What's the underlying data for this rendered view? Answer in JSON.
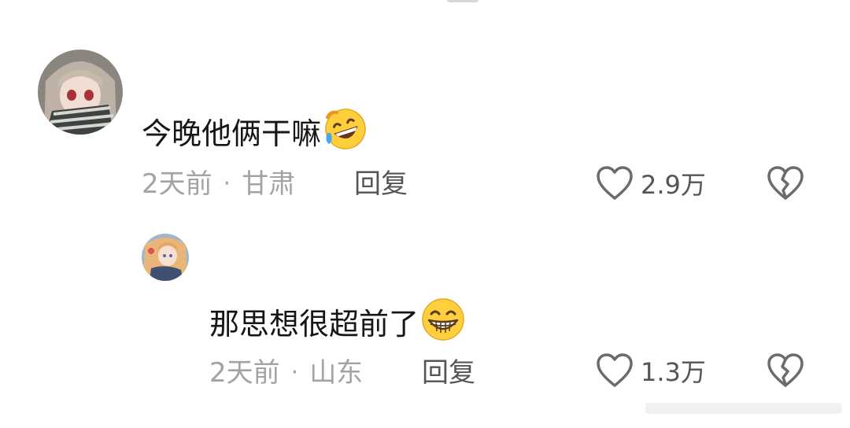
{
  "comments": [
    {
      "text": "今晚他俩干嘛",
      "emoji": "rofl-emoji",
      "time": "2天前",
      "location": "甘肃",
      "reply_label": "回复",
      "likes": "2.9万"
    },
    {
      "text": "那思想很超前了",
      "emoji": "grin-emoji",
      "time": "2天前",
      "location": "山东",
      "reply_label": "回复",
      "likes": "1.3万"
    }
  ],
  "separator": "·",
  "colors": {
    "meta_text": "#a3a3a3",
    "action_text": "#555555",
    "body_text": "#161616"
  }
}
